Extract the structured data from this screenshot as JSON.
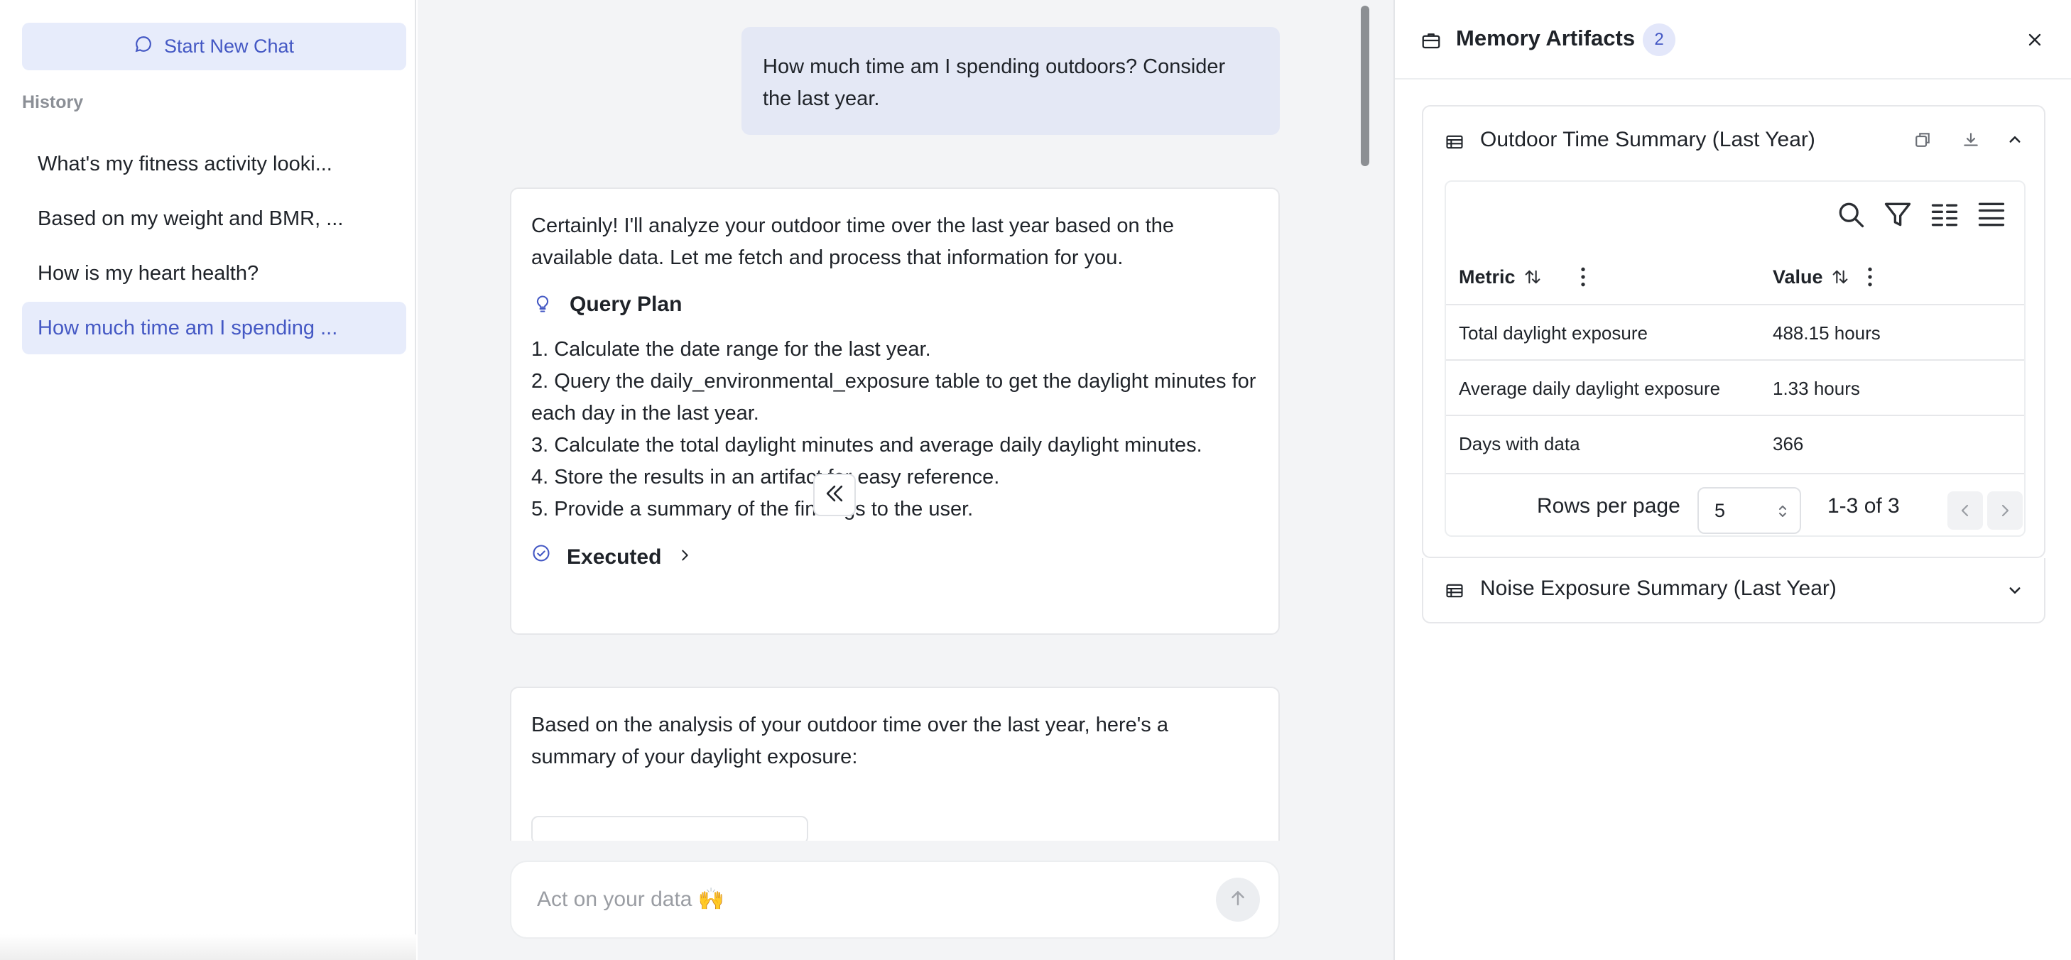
{
  "sidebar": {
    "new_chat_label": "Start New Chat",
    "history_label": "History",
    "history": [
      "What's my fitness activity looki...",
      "Based on my weight and BMR, ...",
      "How is my heart health?",
      "How much time am I spending ..."
    ]
  },
  "chat": {
    "user_message": "How much time am I spending outdoors? Consider the last year.",
    "bot_intro": "Certainly! I'll analyze your outdoor time over the last year based on the available data. Let me fetch and process that information for you.",
    "query_plan_label": "Query Plan",
    "steps": [
      "1. Calculate the date range for the last year.",
      "2. Query the daily_environmental_exposure table to get the daylight minutes for each day in the last year.",
      "3. Calculate the total daylight minutes and average daily daylight minutes.",
      "4. Store the results in an artifact for easy reference.",
      "5. Provide a summary of the findings to the user."
    ],
    "executed_label": "Executed",
    "summary_text": "Based on the analysis of your outdoor time over the last year, here's a summary of your daylight exposure:",
    "input_placeholder": "Act on your data 🙌"
  },
  "panel": {
    "title": "Memory Artifacts",
    "count": "2",
    "artifacts": [
      {
        "title": "Outdoor Time Summary (Last Year)",
        "expanded": true,
        "columns": [
          "Metric",
          "Value"
        ],
        "rows": [
          [
            "Total daylight exposure",
            "488.15 hours"
          ],
          [
            "Average daily daylight exposure",
            "1.33 hours"
          ],
          [
            "Days with data",
            "366"
          ]
        ],
        "rows_per_page_label": "Rows per page",
        "rows_per_page": "5",
        "range_label": "1-3 of 3"
      },
      {
        "title": "Noise Exposure Summary (Last Year)",
        "expanded": false
      }
    ]
  },
  "colors": {
    "accent": "#4458c4",
    "accent_bg": "#e7ecfb",
    "user_bubble": "#e4e8f5",
    "chat_bg": "#f3f4f6"
  }
}
